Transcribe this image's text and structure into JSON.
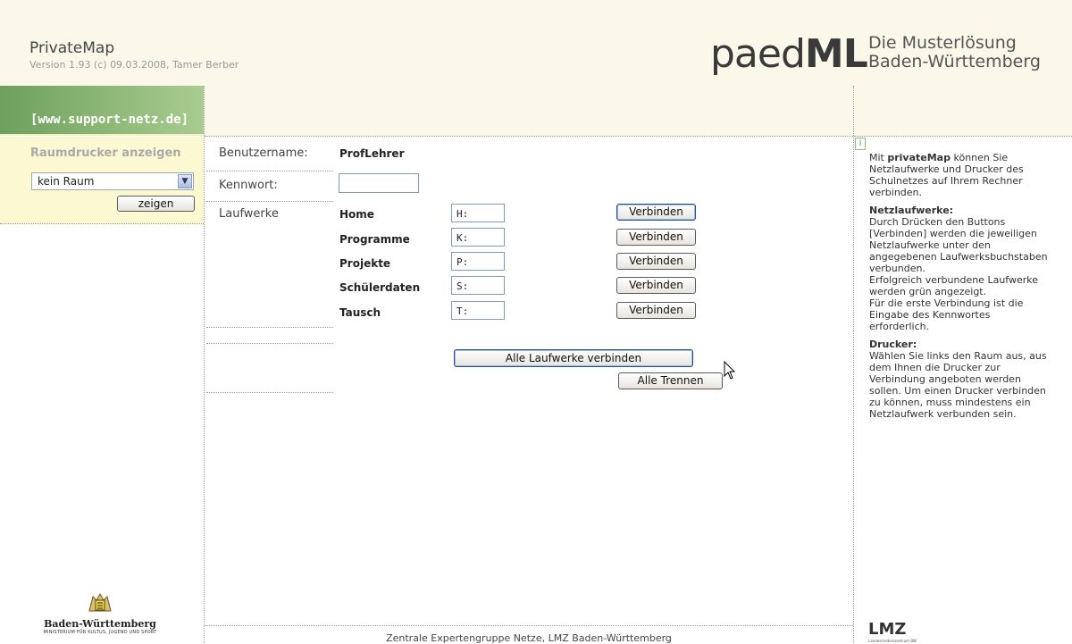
{
  "header": {
    "title": "PrivateMap",
    "version": "Version 1.93 (c) 09.03.2008, Tamer Berber",
    "logo_paed": "paed",
    "logo_ml": "ML",
    "tagline_1": "Die Musterlösung",
    "tagline_2": "Baden-Württemberg"
  },
  "sidebar": {
    "support_link": "[www.support-netz.de]",
    "room_title": "Raumdrucker anzeigen",
    "room_select_value": "kein Raum",
    "show_button": "zeigen",
    "logo_name": "Baden-Württemberg",
    "logo_sub": "MINISTERIUM FÜR KULTUS, JUGEND UND SPORT"
  },
  "form": {
    "username_label": "Benutzername:",
    "username_value": "ProfLehrer",
    "password_label": "Kennwort:",
    "password_value": "",
    "drives_label": "Laufwerke",
    "connect_label": "Verbinden",
    "drives": [
      {
        "name": "Home",
        "letter": "H:"
      },
      {
        "name": "Programme",
        "letter": "K:"
      },
      {
        "name": "Projekte",
        "letter": "P:"
      },
      {
        "name": "Schülerdaten",
        "letter": "S:"
      },
      {
        "name": "Tausch",
        "letter": "T:"
      }
    ],
    "connect_all": "Alle Laufwerke verbinden",
    "disconnect_all": "Alle Trennen"
  },
  "info": {
    "intro_pre": "Mit ",
    "intro_bold": "privateMap",
    "intro_post": " können Sie Netzlaufwerke und Drucker des Schulnetzes auf Ihrem Rechner verbinden.",
    "drives_heading": "Netzlaufwerke:",
    "drives_text": "Durch Drücken den Buttons [Verbinden] werden die jeweiligen Netzlaufwerke unter den angegebenen Laufwerksbuchstaben verbunden.",
    "drives_text2": "Erfolgreich verbundene Laufwerke werden grün angezeigt.",
    "drives_text3": "Für die erste Verbindung ist die Eingabe des Kennwortes erforderlich.",
    "printers_heading": "Drucker:",
    "printers_text": "Wählen Sie links den Raum aus, aus dem Ihnen die Drucker zur Verbindung angeboten werden sollen. Um einen Drucker verbinden zu können, muss mindestens ein Netzlaufwerk verbunden sein.",
    "lmz_logo": "LMZ",
    "lmz_sub": "Landesmedienzentrum BW"
  },
  "footer": {
    "text": "Zentrale Expertengruppe Netze, LMZ Baden-Württemberg"
  },
  "icons": {
    "info": "info-icon",
    "dropdown": "chevron-down-icon",
    "cursor": "mouse-pointer-icon"
  }
}
